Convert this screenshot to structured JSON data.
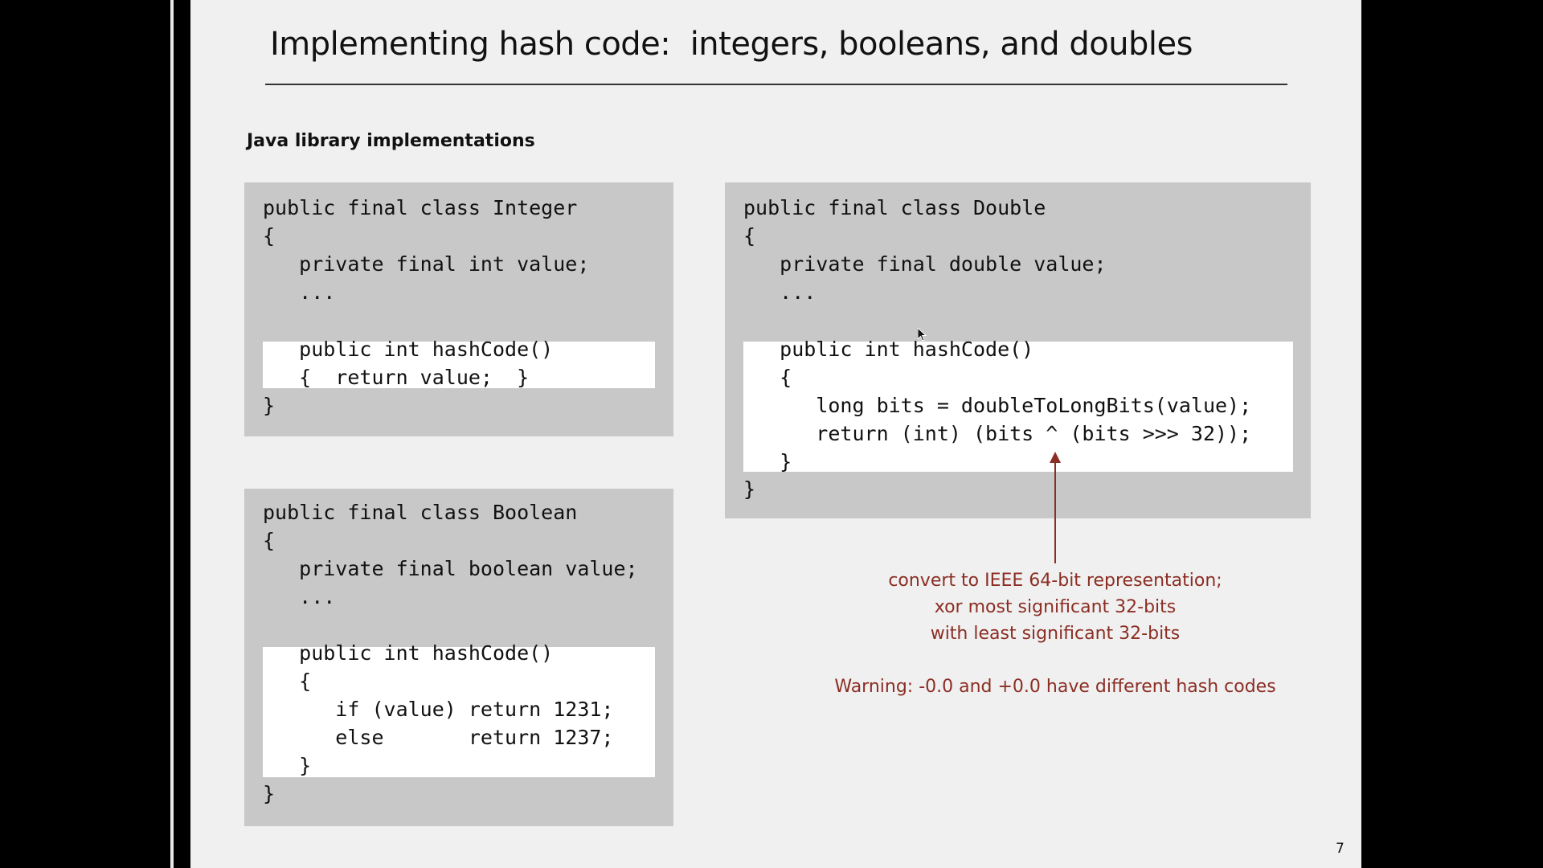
{
  "slide": {
    "title": "Implementing hash code:  integers, booleans, and doubles",
    "subtitle": "Java library implementations",
    "page_number": "7"
  },
  "integer_class": {
    "header": "public final class Integer\n{\n   private final int value;\n   ...",
    "hash_method": "   public int hashCode()\n   {  return value;  }",
    "closing": "}"
  },
  "boolean_class": {
    "header": "public final class Boolean\n{\n   private final boolean value;\n   ...",
    "hash_method": "   public int hashCode()\n   {\n      if (value) return 1231;\n      else       return 1237;\n   }",
    "closing": "}"
  },
  "double_class": {
    "header": "public final class Double\n{\n   private final double value;\n   ...",
    "hash_method": "   public int hashCode()\n   {\n      long bits = doubleToLongBits(value);\n      return (int) (bits ^ (bits >>> 32));\n   }",
    "closing": "}"
  },
  "annotation": {
    "text": "convert to IEEE 64-bit representation;\nxor most significant 32-bits\nwith least significant 32-bits",
    "warning": "Warning: -0.0 and +0.0 have different hash codes"
  },
  "colors": {
    "accent": "#8b2e24",
    "code_box": "#c8c8c8",
    "highlight": "#ffffff",
    "slide_bg": "#f0f0f0"
  }
}
